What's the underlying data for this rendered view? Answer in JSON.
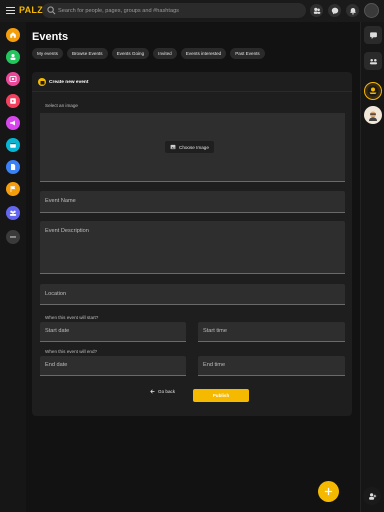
{
  "brand": {
    "logo": "PALZ",
    "accent": "#f5b900"
  },
  "search": {
    "placeholder": "Search for people, pages, groups and #hashtags"
  },
  "page": {
    "title": "Events"
  },
  "tabs": [
    {
      "label": "My events"
    },
    {
      "label": "Browse Events"
    },
    {
      "label": "Events Going"
    },
    {
      "label": "Invited"
    },
    {
      "label": "Events interested"
    },
    {
      "label": "Past Events"
    }
  ],
  "form": {
    "heading": "Create new event",
    "image_label": "Select an image",
    "choose_image": "Choose Image",
    "event_name": "Event Name",
    "event_description": "Event Description",
    "location": "Location",
    "start_label": "When this event will start?",
    "start_date": "Start date",
    "start_time": "Start time",
    "end_label": "When this event will end?",
    "end_date": "End date",
    "end_time": "End time",
    "go_back": "Go back",
    "publish": "Publish"
  },
  "left_rail": [
    {
      "icon": "home-icon",
      "color": "#f59e0b"
    },
    {
      "icon": "users-icon",
      "color": "#22c55e"
    },
    {
      "icon": "photo-icon",
      "color": "#ec4899"
    },
    {
      "icon": "video-icon",
      "color": "#f43f5e"
    },
    {
      "icon": "megaphone-icon",
      "color": "#d946ef"
    },
    {
      "icon": "calendar-icon",
      "color": "#06b6d4"
    },
    {
      "icon": "page-icon",
      "color": "#3b82f6"
    },
    {
      "icon": "flag-icon",
      "color": "#f59e0b"
    },
    {
      "icon": "groups-icon",
      "color": "#6366f1"
    },
    {
      "icon": "more-icon",
      "color": "#3a3a3a"
    }
  ]
}
